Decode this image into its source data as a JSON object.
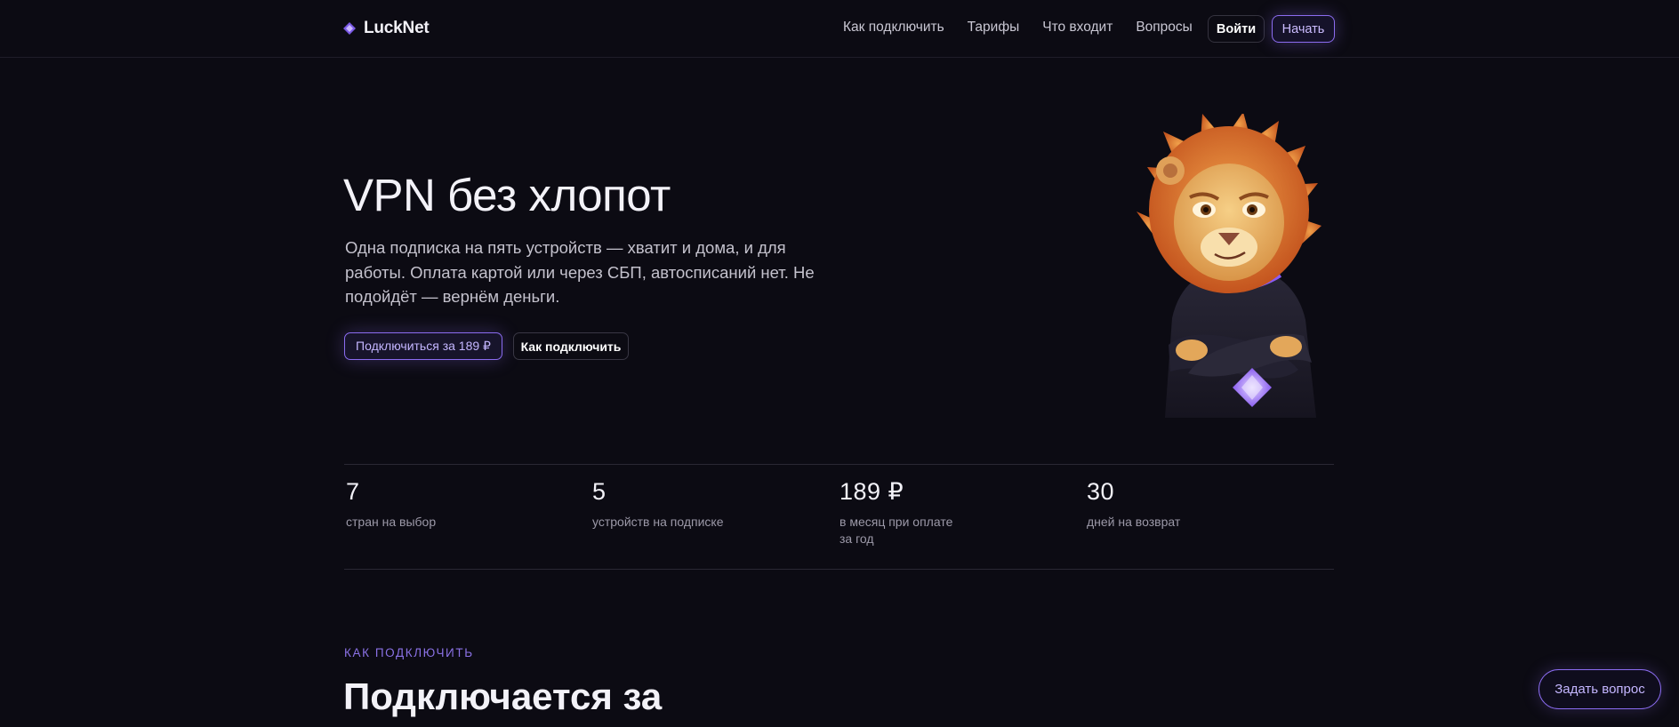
{
  "header": {
    "logo_text": "LuckNet",
    "logo_icon": "diamond-logo-icon",
    "nav": [
      {
        "label": "Как подключить"
      },
      {
        "label": "Тарифы"
      },
      {
        "label": "Что входит"
      },
      {
        "label": "Вопросы"
      }
    ],
    "login_label": "Войти",
    "start_label": "Начать"
  },
  "hero": {
    "title": "VPN без хлопот",
    "description": "Одна подписка на пять устройств — хватит и дома, и для работы. Оплата картой или через СБП, автосписаний нет. Не подойдёт — вернём деньги.",
    "primary_button": "Подключиться за 189 ₽",
    "secondary_button": "Как подключить",
    "mascot": "lion-mascot-image"
  },
  "stats": [
    {
      "value": "7",
      "label": "стран на выбор"
    },
    {
      "value": "5",
      "label": "устройств на подписке"
    },
    {
      "value": "189 ₽",
      "label": "в месяц при оплате за год"
    },
    {
      "value": "30",
      "label": "дней на возврат"
    }
  ],
  "section": {
    "kicker": "КАК ПОДКЛЮЧИТЬ",
    "title": "Подключается за"
  },
  "ask_button": "Задать вопрос",
  "colors": {
    "background": "#0c0b13",
    "accent": "#8b6cf0",
    "text": "#ecebf2",
    "muted": "#9c99a8"
  }
}
